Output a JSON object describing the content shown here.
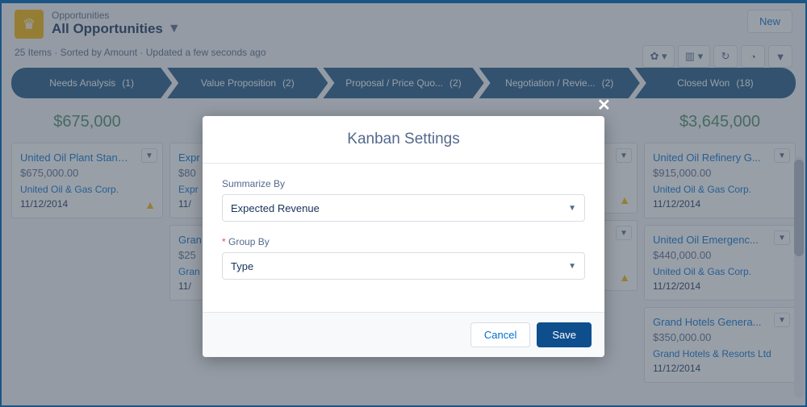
{
  "header": {
    "object_type": "Opportunities",
    "title": "All Opportunities",
    "new_button": "New"
  },
  "meta": "25 Items · Sorted by Amount · Updated a few seconds ago",
  "stages": [
    {
      "label": "Needs Analysis",
      "count": "(1)",
      "total": "$675,000"
    },
    {
      "label": "Value Proposition",
      "count": "(2)",
      "total": ""
    },
    {
      "label": "Proposal / Price Quo...",
      "count": "(2)",
      "total": ""
    },
    {
      "label": "Negotiation / Revie...",
      "count": "(2)",
      "total": ""
    },
    {
      "label": "Closed Won",
      "count": "(18)",
      "total": "$3,645,000"
    }
  ],
  "col0": {
    "card0": {
      "name": "United Oil Plant Standby...",
      "amount": "$675,000.00",
      "acct": "United Oil & Gas Corp.",
      "date": "11/12/2014"
    }
  },
  "col1": {
    "card0": {
      "name": "Expr",
      "amount": "$80",
      "acct": "Expr",
      "date": "11/"
    },
    "card1": {
      "name": "Gran",
      "amount": "$25",
      "acct": "Gran",
      "date": "11/"
    }
  },
  "col4": {
    "card0": {
      "name": "United Oil Refinery G...",
      "amount": "$915,000.00",
      "acct": "United Oil & Gas Corp.",
      "date": "11/12/2014"
    },
    "card1": {
      "name": "United Oil Emergenc...",
      "amount": "$440,000.00",
      "acct": "United Oil & Gas Corp.",
      "date": "11/12/2014"
    },
    "card2": {
      "name": "Grand Hotels Genera...",
      "amount": "$350,000.00",
      "acct": "Grand Hotels & Resorts Ltd",
      "date": "11/12/2014"
    }
  },
  "modal": {
    "title": "Kanban Settings",
    "summarize_label": "Summarize By",
    "summarize_value": "Expected Revenue",
    "group_label": "Group By",
    "group_value": "Type",
    "cancel": "Cancel",
    "save": "Save"
  }
}
